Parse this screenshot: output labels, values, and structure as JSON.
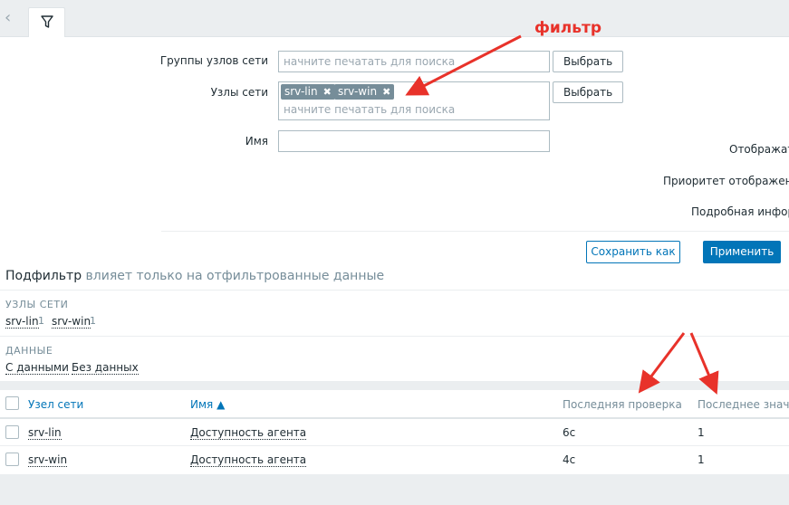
{
  "filter": {
    "host_groups_label": "Группы узлов сети",
    "host_groups_placeholder": "начните печатать для поиска",
    "hosts_label": "Узлы сети",
    "hosts_tags": [
      "srv-lin",
      "srv-win"
    ],
    "hosts_placeholder": "начните печатать для поиска",
    "name_label": "Имя",
    "name_value": "",
    "select_label": "Выбрать",
    "right_labels": [
      "Отображать",
      "Приоритет отображения",
      "Подробная информ"
    ],
    "save_as_label": "Сохранить как",
    "apply_label": "Применить"
  },
  "annotation": {
    "filter_text": "фильтр"
  },
  "subfilter": {
    "title": "Подфильтр",
    "title_note": "влияет только на отфильтрованные данные",
    "hosts_heading": "УЗЛЫ СЕТИ",
    "hosts": [
      {
        "name": "srv-lin",
        "count": "1"
      },
      {
        "name": "srv-win",
        "count": "1"
      }
    ],
    "data_heading": "ДАННЫЕ",
    "data_items": [
      "С данными",
      "Без данных"
    ]
  },
  "table": {
    "columns": [
      "Узел сети",
      "Имя ▲",
      "Последняя проверка",
      "Последнее значен"
    ],
    "rows": [
      {
        "host": "srv-lin",
        "name": "Доступность агента",
        "last_check": "6с",
        "last_value": "1"
      },
      {
        "host": "srv-win",
        "name": "Доступность агента",
        "last_check": "4с",
        "last_value": "1"
      }
    ]
  },
  "colors": {
    "accent": "#0275b8",
    "annotation": "#e8322a",
    "tag": "#768d99"
  }
}
